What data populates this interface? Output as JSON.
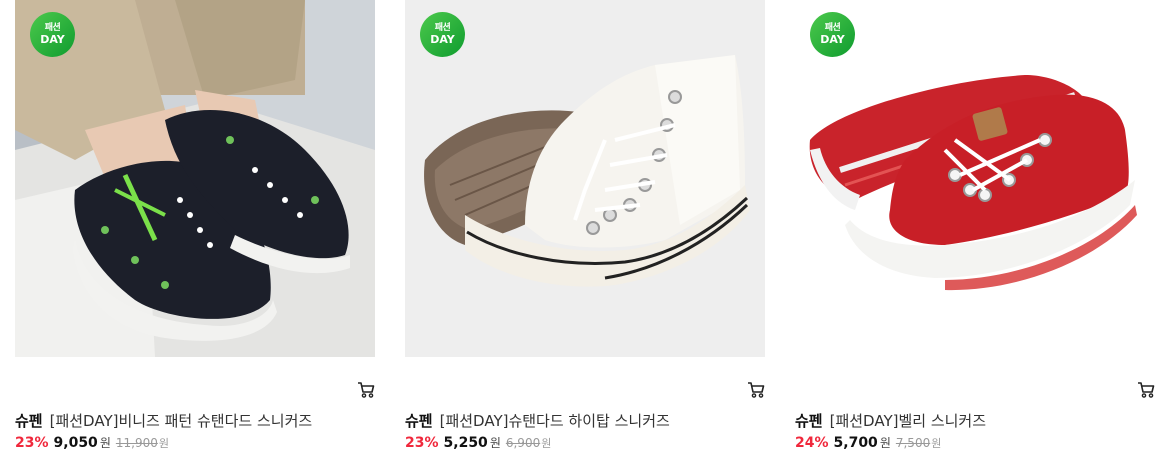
{
  "products": [
    {
      "badge": {
        "line1": "패션",
        "line2": "DAY"
      },
      "brand": "슈펜",
      "name": "[패션DAY]비니즈 패턴 슈탠다드 스니커즈",
      "discount": "23%",
      "price": "9,050",
      "currency": "원",
      "original_price": "11,900",
      "original_currency": "원",
      "image": "model-wearing-black-printed-low-sneakers"
    },
    {
      "badge": {
        "line1": "패션",
        "line2": "DAY"
      },
      "brand": "슈펜",
      "name": "[패션DAY]슈탠다드 하이탑 스니커즈",
      "discount": "23%",
      "price": "5,250",
      "currency": "원",
      "original_price": "6,900",
      "original_currency": "원",
      "image": "white-high-top-sneakers"
    },
    {
      "badge": {
        "line1": "패션",
        "line2": "DAY"
      },
      "brand": "슈펜",
      "name": "[패션DAY]벨리 스니커즈",
      "discount": "24%",
      "price": "5,700",
      "currency": "원",
      "original_price": "7,500",
      "original_currency": "원",
      "image": "red-low-top-sneakers"
    }
  ],
  "icons": {
    "cart": "cart-icon"
  },
  "colors": {
    "discount": "#f0283c",
    "badge": "#1aa83a"
  }
}
